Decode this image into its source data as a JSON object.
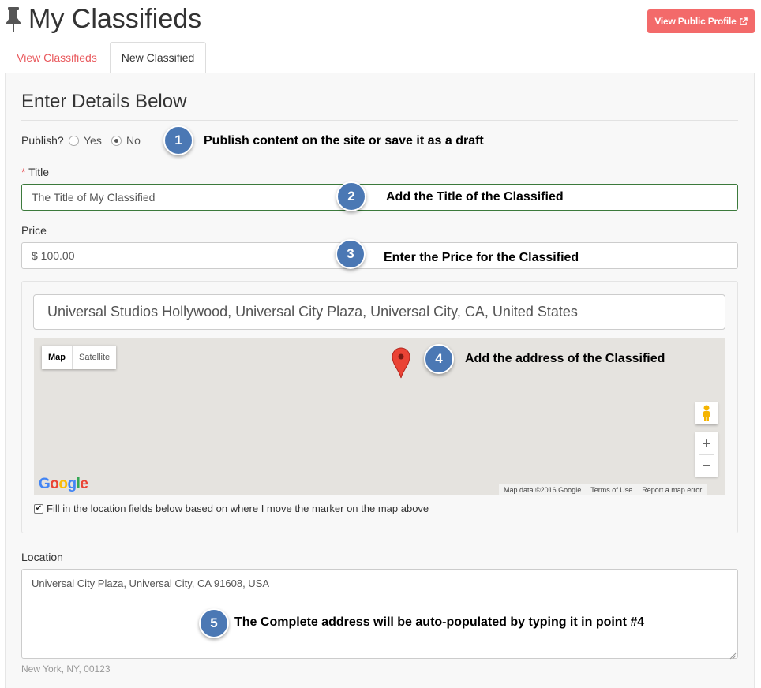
{
  "header": {
    "icon": "pushpin-icon",
    "title": "My Classifieds",
    "public_profile_button": "View Public Profile",
    "public_profile_icon": "external-link-icon"
  },
  "tabs": [
    {
      "label": "View Classifieds",
      "active": false
    },
    {
      "label": "New Classified",
      "active": true
    }
  ],
  "form": {
    "section_title": "Enter Details Below",
    "publish": {
      "label": "Publish?",
      "options": [
        "Yes",
        "No"
      ],
      "selected": "No"
    },
    "title": {
      "required_mark": "*",
      "label": "Title",
      "value": "The Title of My Classified"
    },
    "price": {
      "label": "Price",
      "value": "$ 100.00"
    },
    "address_search": {
      "value": "Universal Studios Hollywood, Universal City Plaza, Universal City, CA, United States"
    },
    "map": {
      "type_buttons": [
        "Map",
        "Satellite"
      ],
      "active_type": "Map",
      "logo": "Google",
      "footer": [
        "Map data ©2016 Google",
        "Terms of Use",
        "Report a map error"
      ],
      "zoom_in": "+",
      "zoom_out": "−"
    },
    "auto_fill_checkbox": {
      "checked": true,
      "label": "Fill in the location fields below based on where I move the marker on the map above"
    },
    "location": {
      "label": "Location",
      "value": "Universal City Plaza, Universal City, CA 91608, USA",
      "help_text": "New York, NY, 00123"
    }
  },
  "annotations": [
    {
      "number": "1",
      "text": "Publish content on the site or save it as a draft"
    },
    {
      "number": "2",
      "text": "Add the Title of the Classified"
    },
    {
      "number": "3",
      "text": "Enter the Price for the Classified"
    },
    {
      "number": "4",
      "text": "Add the address of the Classified"
    },
    {
      "number": "5",
      "text": "The Complete address will be auto-populated by typing it in point #4"
    }
  ],
  "colors": {
    "accent": "#f36a6a",
    "tab_text": "#e9595d",
    "badge": "#4b78b4",
    "title_border": "#3c7a3c"
  }
}
